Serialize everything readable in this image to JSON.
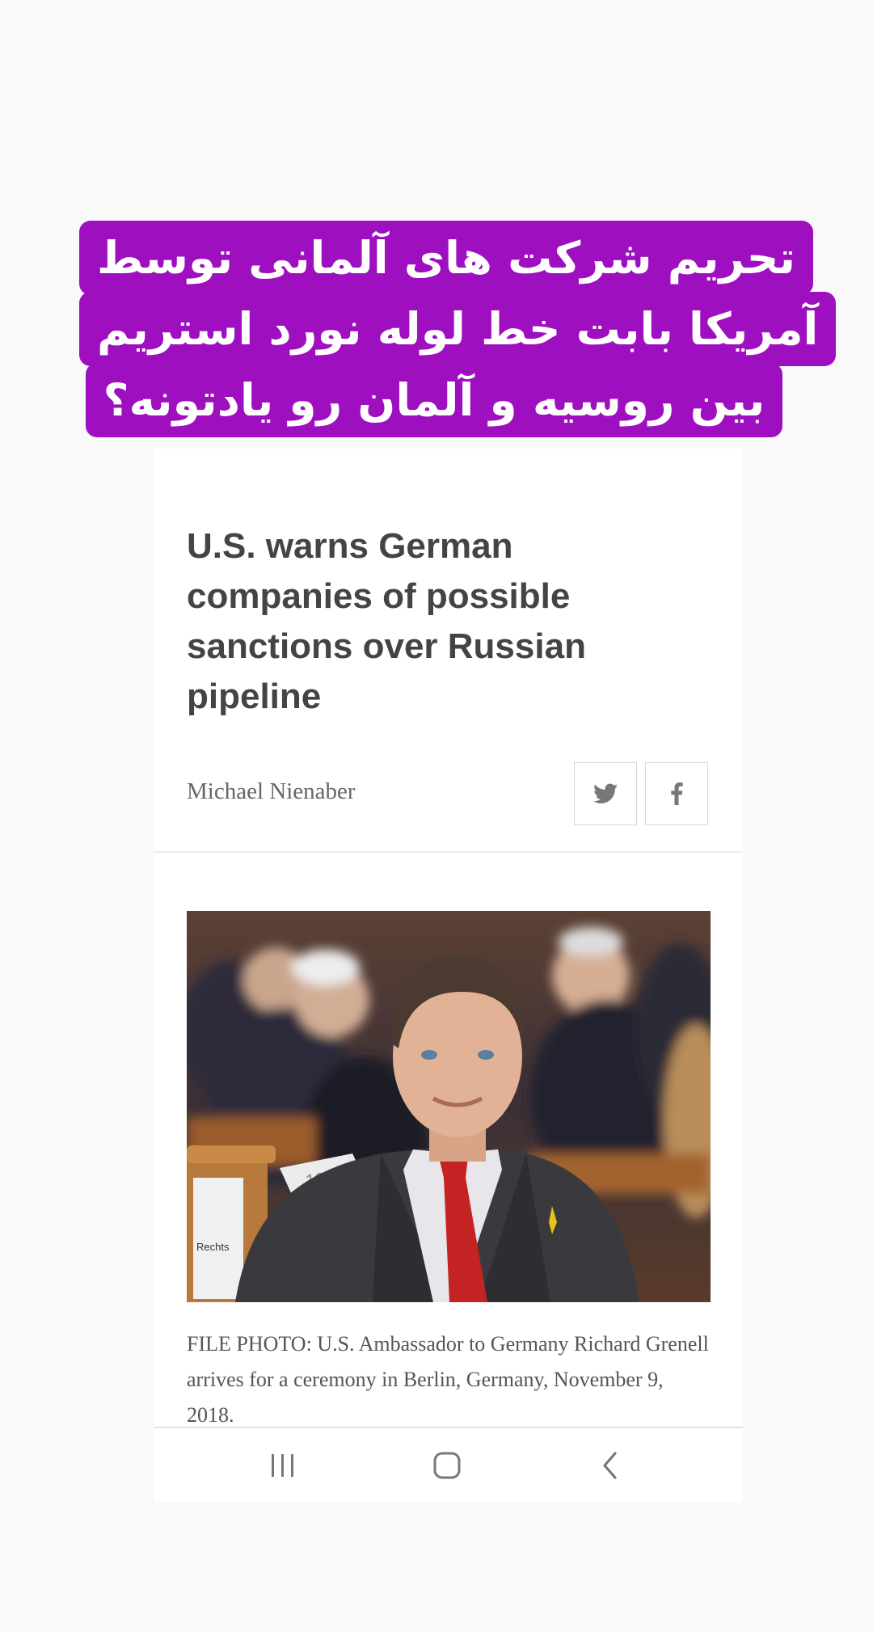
{
  "overlay": {
    "lines": [
      "تحریم شرکت های آلمانی توسط",
      "آمریکا بابت خط لوله نورد استریم",
      "بین روسیه و آلمان رو یادتونه؟"
    ],
    "background": "#9e0fc0"
  },
  "article": {
    "headline": "U.S. warns German companies of possible sanctions over Russian pipeline",
    "author": "Michael Nienaber",
    "share": [
      "twitter-icon",
      "facebook-icon"
    ],
    "photo": {
      "label": "Rechts",
      "card_number": "19"
    },
    "caption": "FILE PHOTO: U.S. Ambassador to Germany Richard Grenell arrives for a ceremony in Berlin, Germany, November 9, 2018."
  },
  "navbar": {
    "buttons": [
      "recents-icon",
      "home-icon",
      "back-icon"
    ]
  },
  "colors": {
    "headline": "#444444",
    "text": "#555555",
    "page": "#f9f9f9"
  }
}
